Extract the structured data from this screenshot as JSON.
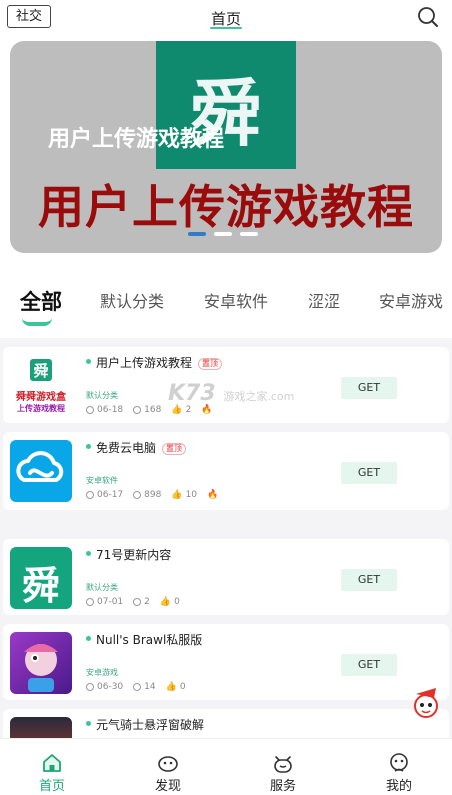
{
  "header": {
    "social_label": "社交",
    "title": "首页"
  },
  "banner": {
    "logo_char": "舜",
    "subtitle": "用户上传游戏教程",
    "title": "用户上传游戏教程",
    "slide_count": 3,
    "active_slide": 1
  },
  "categories": [
    {
      "label": "全部",
      "active": true
    },
    {
      "label": "默认分类",
      "active": false
    },
    {
      "label": "安卓软件",
      "active": false
    },
    {
      "label": "涩涩",
      "active": false
    },
    {
      "label": "安卓游戏",
      "active": false
    }
  ],
  "apps": [
    {
      "name": "用户上传游戏教程",
      "badge": "置顶",
      "tag": "默认分类",
      "date": "06-18",
      "downloads": "168",
      "likes": "2",
      "hot": true,
      "get_label": "GET",
      "icon_line1": "舜舜游戏盒",
      "icon_line2": "上传游戏教程"
    },
    {
      "name": "免费云电脑",
      "badge": "置顶",
      "tag": "安卓软件",
      "date": "06-17",
      "downloads": "898",
      "likes": "10",
      "hot": true,
      "get_label": "GET"
    },
    {
      "name": "71号更新内容",
      "badge": "",
      "tag": "默认分类",
      "date": "07-01",
      "downloads": "2",
      "likes": "0",
      "hot": false,
      "get_label": "GET"
    },
    {
      "name": "Null's Brawl私服版",
      "badge": "",
      "tag": "安卓游戏",
      "date": "06-30",
      "downloads": "14",
      "likes": "0",
      "hot": false,
      "get_label": "GET"
    },
    {
      "name": "元气骑士悬浮窗破解",
      "badge": "",
      "tag": "",
      "date": "",
      "downloads": "",
      "likes": "",
      "hot": false,
      "get_label": ""
    }
  ],
  "watermark": {
    "main": "K73",
    "sub": "游戏之家",
    "domain": ".com"
  },
  "tabbar": [
    {
      "label": "首页",
      "icon": "home-icon",
      "active": true
    },
    {
      "label": "发现",
      "icon": "discover-icon",
      "active": false
    },
    {
      "label": "服务",
      "icon": "service-icon",
      "active": false
    },
    {
      "label": "我的",
      "icon": "profile-icon",
      "active": false
    }
  ],
  "colors": {
    "accent": "#3cc59c",
    "active_tab": "#19a874",
    "banner_title": "#9a0c0c",
    "logo_green": "#0f8a6f"
  }
}
